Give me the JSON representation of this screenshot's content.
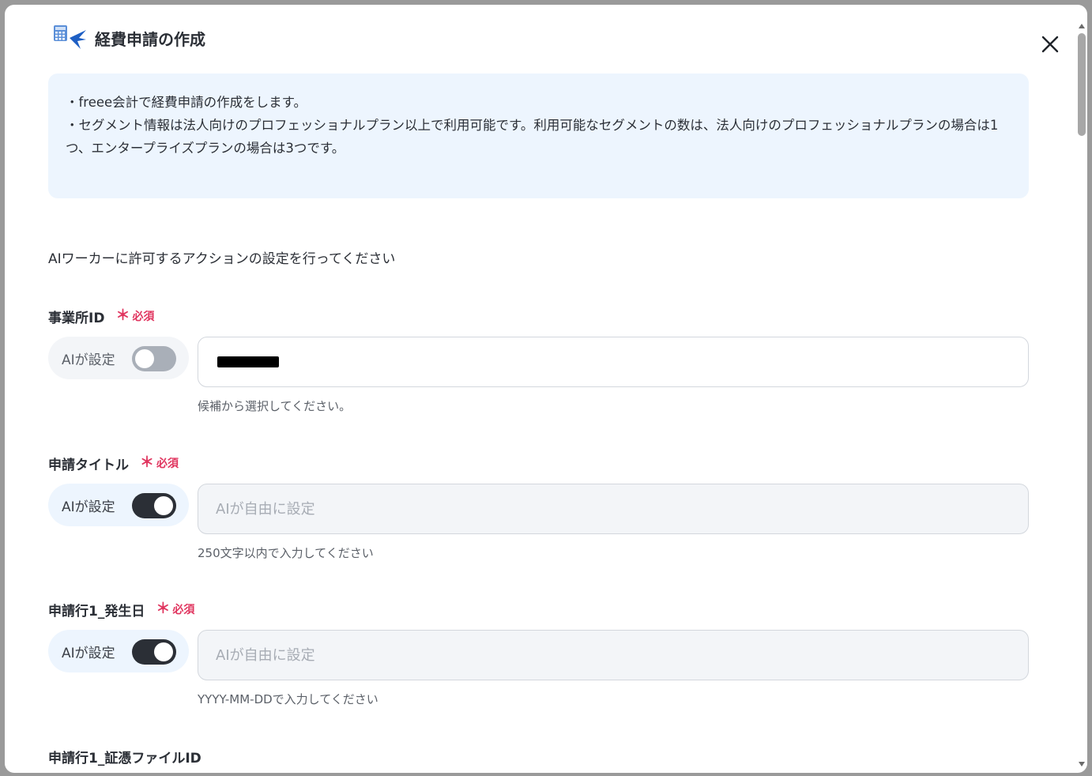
{
  "modal": {
    "title": "経費申請の作成",
    "icon": "freee-calculator-bird-icon"
  },
  "info": {
    "lines": [
      "・freee会計で経費申請の作成をします。",
      "・セグメント情報は法人向けのプロフェッショナルプラン以上で利用可能です。利用可能なセグメントの数は、法人向けのプロフェッショナルプランの場合は1つ、エンタープライズプランの場合は3つです。"
    ]
  },
  "section": {
    "heading": "AIワーカーに許可するアクションの設定を行ってください"
  },
  "required_label": "必須",
  "required_star": "＊",
  "ai_toggle_label": "AIが設定",
  "fields": [
    {
      "label": "事業所ID",
      "required": true,
      "ai_enabled": false,
      "value": "",
      "value_redacted": true,
      "placeholder": "",
      "hint": "候補から選択してください。"
    },
    {
      "label": "申請タイトル",
      "required": true,
      "ai_enabled": true,
      "value": "",
      "placeholder": "AIが自由に設定",
      "hint": "250文字以内で入力してください"
    },
    {
      "label": "申請行1_発生日",
      "required": true,
      "ai_enabled": true,
      "value": "",
      "placeholder": "AIが自由に設定",
      "hint": "YYYY-MM-DDで入力してください"
    },
    {
      "label": "申請行1_証憑ファイルID",
      "required": false
    }
  ],
  "colors": {
    "accent_required": "#e0355f",
    "info_background": "#edf5fe",
    "toggle_on": "#2b2f36",
    "toggle_off": "#a9afb8"
  }
}
